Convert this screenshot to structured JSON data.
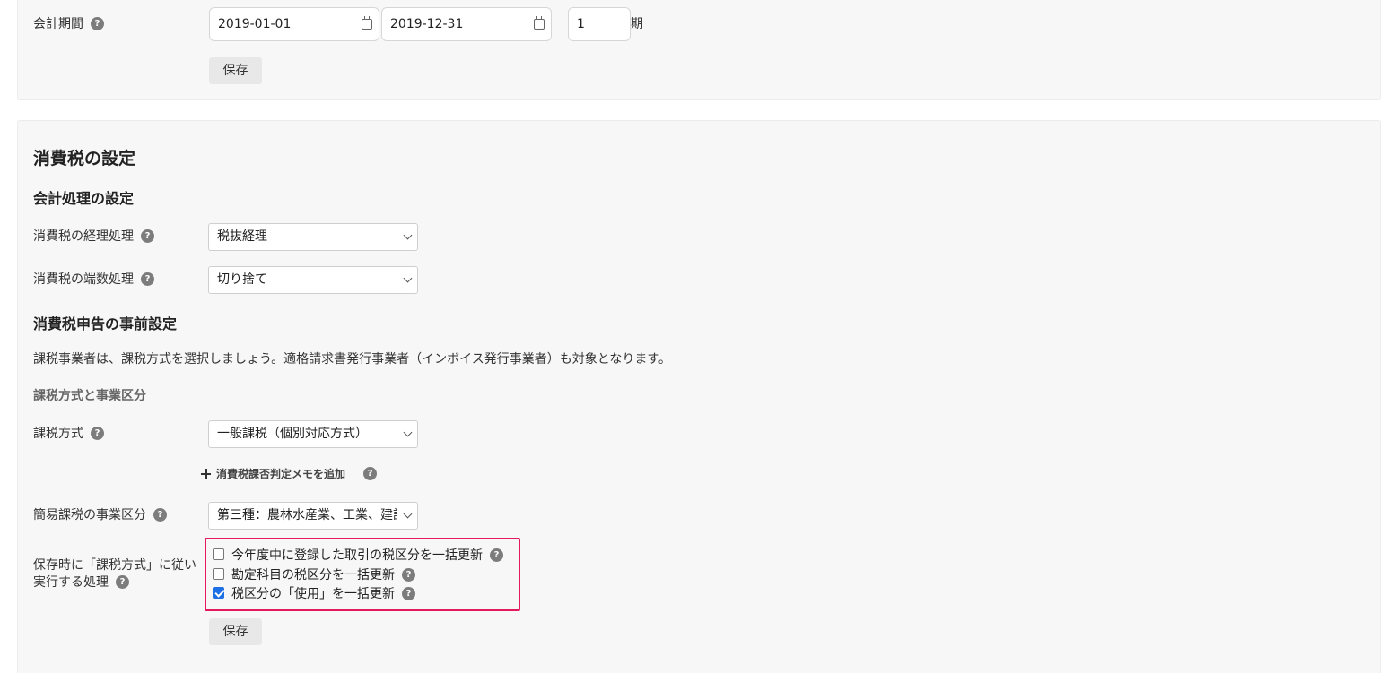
{
  "accounting_period": {
    "label": "会計期間",
    "start_date": "2019-01-01",
    "end_date": "2019-12-31",
    "period_number": "1",
    "period_suffix": "期",
    "save_label": "保存"
  },
  "tax_settings": {
    "title": "消費税の設定",
    "accounting_section": {
      "title": "会計処理の設定",
      "accounting_method": {
        "label": "消費税の経理処理",
        "value": "税抜経理"
      },
      "rounding_method": {
        "label": "消費税の端数処理",
        "value": "切り捨て"
      }
    },
    "filing_section": {
      "title": "消費税申告の事前設定",
      "description": "課税事業者は、課税方式を選択しましょう。適格請求書発行事業者（インボイス発行事業者）も対象となります。",
      "subsection_title": "課税方式と事業区分",
      "taxation_method": {
        "label": "課税方式",
        "value": "一般課税（個別対応方式）"
      },
      "add_memo_label": "消費税課否判定メモを追加",
      "business_category": {
        "label": "簡易課税の事業区分",
        "value": "第三種：農林水産業、工業、建設業"
      },
      "on_save_actions": {
        "label_line1": "保存時に「課税方式」に従い",
        "label_line2": "実行する処理",
        "options": [
          {
            "label": "今年度中に登録した取引の税区分を一括更新",
            "checked": false
          },
          {
            "label": "勘定科目の税区分を一括更新",
            "checked": false
          },
          {
            "label": "税区分の「使用」を一括更新",
            "checked": true
          }
        ]
      },
      "save_label": "保存"
    }
  },
  "help_glyph": "?",
  "colors": {
    "highlight_border": "#e5195e",
    "checkbox_checked": "#1e6fe6",
    "panel_background": "#f7f7f7"
  }
}
